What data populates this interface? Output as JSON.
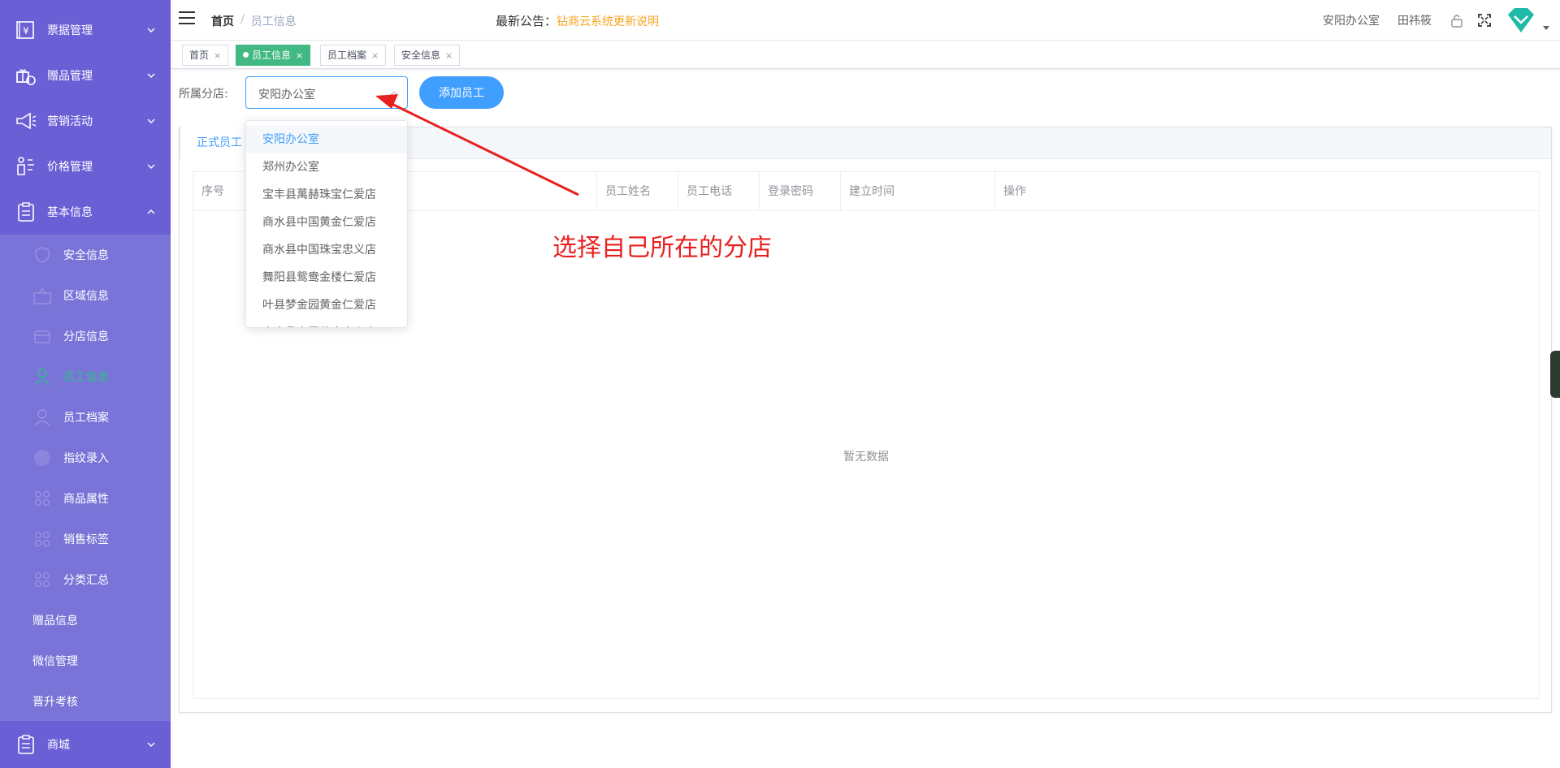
{
  "sidebar": {
    "menus": [
      {
        "label": "票据管理",
        "icon": "receipt-icon"
      },
      {
        "label": "赠品管理",
        "icon": "gift-icon"
      },
      {
        "label": "营销活动",
        "icon": "megaphone-icon"
      },
      {
        "label": "价格管理",
        "icon": "price-tag-icon"
      },
      {
        "label": "基本信息",
        "icon": "clipboard-icon"
      }
    ],
    "submenu": [
      {
        "label": "安全信息",
        "icon": "shield-icon"
      },
      {
        "label": "区域信息",
        "icon": "region-icon"
      },
      {
        "label": "分店信息",
        "icon": "store-icon"
      },
      {
        "label": "员工信息",
        "icon": "user-icon",
        "active": true
      },
      {
        "label": "员工档案",
        "icon": "user-icon"
      },
      {
        "label": "指纹录入",
        "icon": "fingerprint-icon"
      },
      {
        "label": "商品属性",
        "icon": "grid-icon"
      },
      {
        "label": "销售标签",
        "icon": "grid-icon"
      },
      {
        "label": "分类汇总",
        "icon": "grid-icon"
      },
      {
        "label": "赠品信息"
      },
      {
        "label": "微信管理"
      },
      {
        "label": "晋升考核"
      }
    ],
    "mall": {
      "label": "商城",
      "icon": "clipboard-icon"
    }
  },
  "header": {
    "breadcrumb": {
      "home": "首页",
      "separator": "/",
      "current": "员工信息"
    },
    "notice_label": "最新公告：",
    "notice_link": "钻商云系统更新说明",
    "branch": "安阳办公室",
    "user": "田祎筱",
    "lock_icon": "lock-icon",
    "fullscreen_icon": "fullscreen-icon",
    "avatar_icon": "diamond-avatar-icon"
  },
  "tags": [
    {
      "label": "首页",
      "active": false
    },
    {
      "label": "员工信息",
      "active": true
    },
    {
      "label": "员工档案",
      "active": false
    },
    {
      "label": "安全信息",
      "active": false
    }
  ],
  "filter": {
    "label": "所属分店:",
    "selected": "安阳办公室",
    "add_button": "添加员工"
  },
  "dropdown": {
    "options": [
      "安阳办公室",
      "郑州办公室",
      "宝丰县萬赫珠宝仁爱店",
      "商水县中国黄金仁爱店",
      "商水县中国珠宝忠义店",
      "舞阳县鸳鸯金楼仁爱店",
      "叶县梦金园黄金仁爱店",
      "商水县中国黄金忠义店"
    ]
  },
  "card": {
    "tab": "正式员工",
    "columns": [
      "序号",
      "",
      "员工姓名",
      "员工电话",
      "登录密码",
      "建立时间",
      "操作"
    ],
    "empty_text": "暂无数据"
  },
  "annotation": {
    "text": "选择自己所在的分店",
    "color": "#e8211f"
  },
  "colors": {
    "sidebar": "#6b5fd6",
    "submenu": "#7a74d8",
    "active_green": "#42b983",
    "primary": "#409eff",
    "notice": "#f5a623"
  }
}
